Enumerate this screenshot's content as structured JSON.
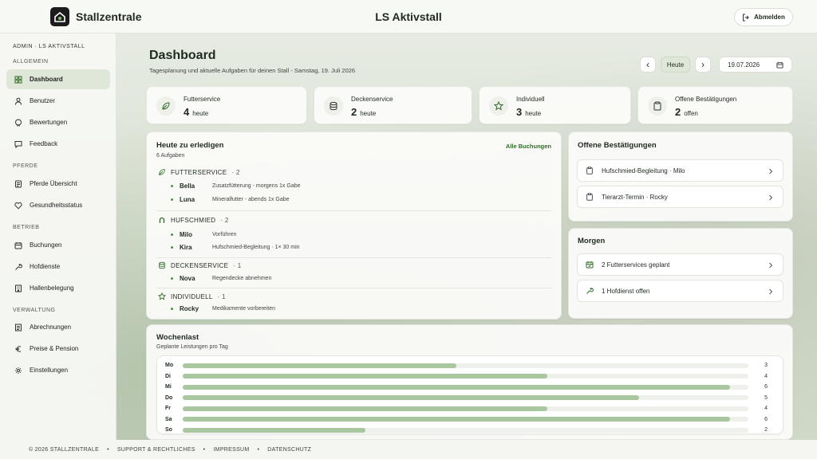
{
  "app": {
    "brand": "Stallzentrale",
    "stall": "LS Aktivstall",
    "logout": "Abmelden"
  },
  "sidebar": {
    "context": "ADMIN · LS AKTIVSTALL",
    "sections": [
      {
        "title": "ALLGEMEIN",
        "items": [
          "Dashboard",
          "Benutzer",
          "Bewertungen",
          "Feedback"
        ]
      },
      {
        "title": "PFERDE",
        "items": [
          "Pferde Übersicht",
          "Gesundheitsstatus"
        ]
      },
      {
        "title": "BETRIEB",
        "items": [
          "Buchungen",
          "Hofdienste",
          "Hallenbelegung"
        ]
      },
      {
        "title": "VERWALTUNG",
        "items": [
          "Abrechnungen",
          "Preise & Pension",
          "Einstellungen"
        ]
      }
    ],
    "active": "Dashboard"
  },
  "header": {
    "title": "Dashboard",
    "subtitle": "Tagesplanung und aktuelle Aufgaben für deinen Stall - Samstag, 19. Juli 2026",
    "prev": "‹",
    "today": "Heute",
    "next": "›",
    "date": "19.07.2026"
  },
  "stats": [
    {
      "label": "Futterservice",
      "value": "4",
      "unit": "heute",
      "icon": "leaf-icon"
    },
    {
      "label": "Deckenservice",
      "value": "2",
      "unit": "heute",
      "icon": "stack-icon"
    },
    {
      "label": "Individuell",
      "value": "3",
      "unit": "heute",
      "icon": "star-icon"
    },
    {
      "label": "Offene Bestätigungen",
      "value": "2",
      "unit": "offen",
      "icon": "clipboard-icon"
    }
  ],
  "today": {
    "title": "Heute zu erledigen",
    "count": "6 Aufgaben",
    "link": "Alle Buchungen",
    "groups": [
      {
        "name": "FUTTERSERVICE",
        "count": "· 2",
        "icon": "leaf-icon",
        "rows": [
          {
            "horse": "Bella",
            "desc": "Zusatzfütterung - morgens 1x Gabe"
          },
          {
            "horse": "Luna",
            "desc": "Mineralfutter - abends 1x Gabe"
          }
        ]
      },
      {
        "name": "HUFSCHMIED",
        "count": "· 2",
        "icon": "horseshoe-icon",
        "rows": [
          {
            "horse": "Milo",
            "desc": "Vorführen"
          },
          {
            "horse": "Kira",
            "desc": "Hufschmied-Begleitung · 1× 30 min"
          }
        ]
      },
      {
        "name": "DECKENSERVICE",
        "count": "· 1",
        "icon": "stack-icon",
        "rows": [
          {
            "horse": "Nova",
            "desc": "Regendecke abnehmen"
          }
        ]
      },
      {
        "name": "INDIVIDUELL",
        "count": "· 1",
        "icon": "star-icon",
        "rows": [
          {
            "horse": "Rocky",
            "desc": "Medikamente vorbereiten"
          }
        ]
      }
    ]
  },
  "confirmations": {
    "title": "Offene Bestätigungen",
    "items": [
      "Hufschmied-Begleitung · Milo",
      "Tierarzt-Termin · Rocky"
    ]
  },
  "tomorrow": {
    "title": "Morgen",
    "items": [
      "2 Futterservices geplant",
      "1 Hofdienst offen"
    ]
  },
  "chart_data": {
    "type": "bar",
    "title": "Wochenlast",
    "subtitle": "Geplante Leistungen pro Tag",
    "categories": [
      "Mo",
      "Di",
      "Mi",
      "Do",
      "Fr",
      "Sa",
      "So"
    ],
    "values": [
      3,
      4,
      6,
      5,
      4,
      6,
      2
    ],
    "orientation": "horizontal",
    "xlim": [
      0,
      6.2
    ]
  },
  "footer": [
    "© 2026 STALLZENTRALE",
    "•",
    "SUPPORT & RECHTLICHES",
    "•",
    "IMPRESSUM",
    "•",
    "DATENSCHUTZ"
  ],
  "colors": {
    "accent": "#2f6b28",
    "bar": "#a9c79e",
    "active": "#dfe8d8"
  }
}
